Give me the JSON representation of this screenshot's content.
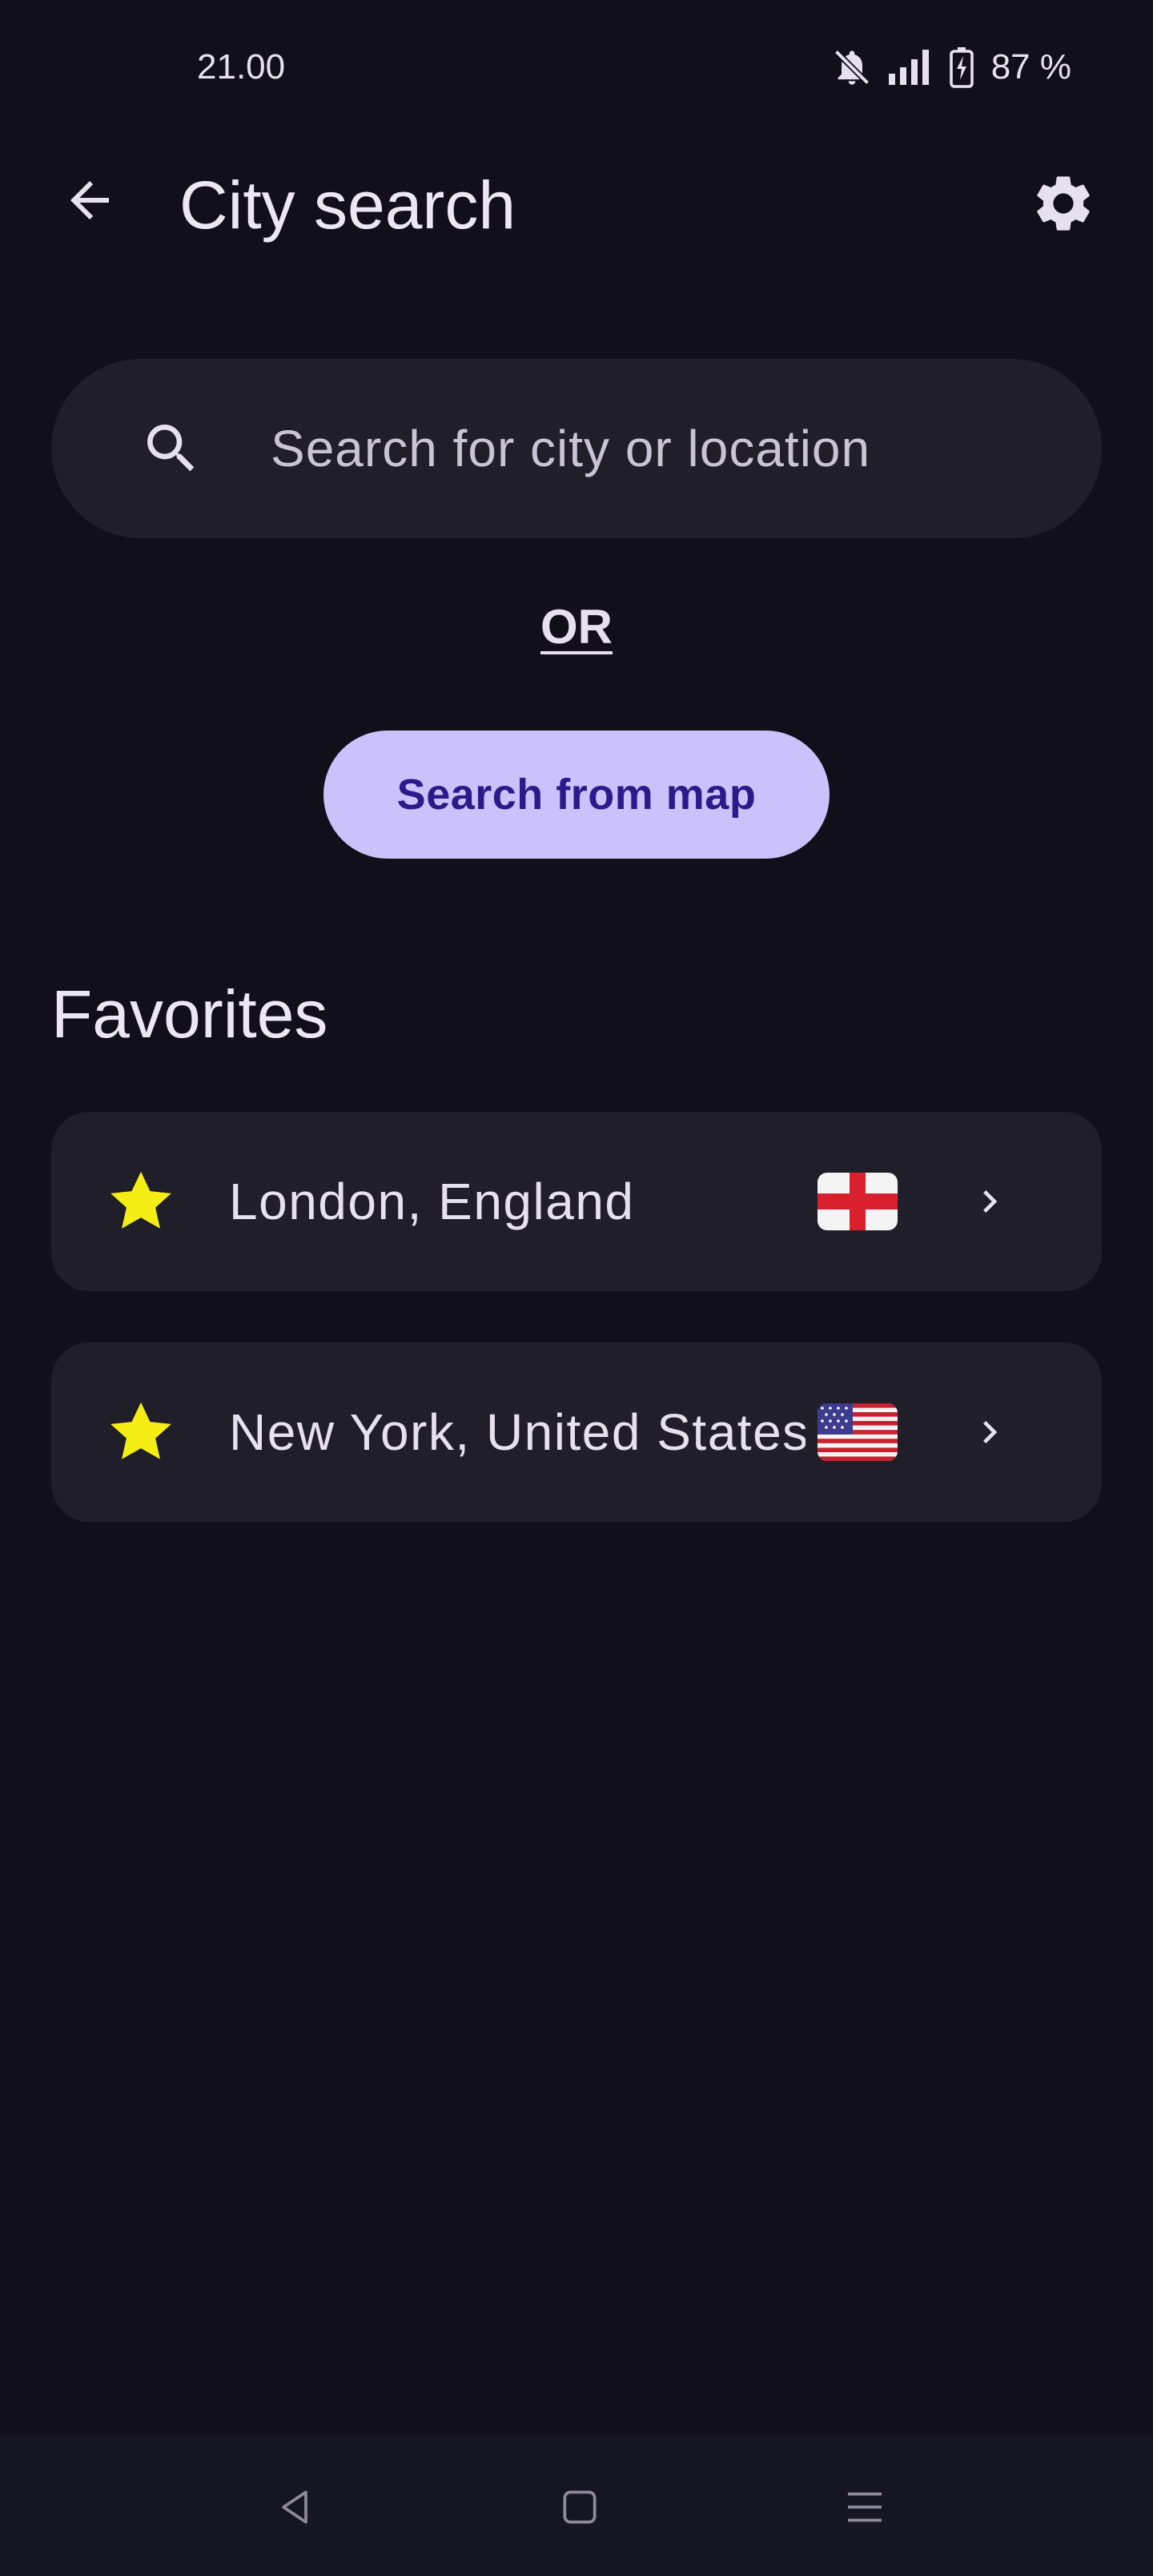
{
  "status_bar": {
    "time": "21.00",
    "battery_percent": "87 %",
    "icons": [
      "bell-muted-icon",
      "signal-icon",
      "battery-charging-icon"
    ]
  },
  "app_bar": {
    "title": "City search",
    "back_icon": "arrow-left-icon",
    "settings_icon": "gear-icon"
  },
  "search": {
    "placeholder": "Search for city or location",
    "value": "",
    "icon": "search-icon"
  },
  "divider_text": "OR",
  "map_button": {
    "label": "Search from map"
  },
  "favorites": {
    "title": "Favorites",
    "items": [
      {
        "name": "London, England",
        "flag": "england-flag-icon"
      },
      {
        "name": "New York, United States",
        "flag": "us-flag-icon"
      }
    ]
  },
  "colors": {
    "background": "#100f1a",
    "surface": "#1f1e29",
    "primary_container": "#cbc2fb",
    "on_primary_container": "#2d1a8a",
    "star": "#f4ee15"
  },
  "nav_bar": {
    "buttons": [
      "back-triangle-icon",
      "home-square-icon",
      "recents-menu-icon"
    ]
  }
}
